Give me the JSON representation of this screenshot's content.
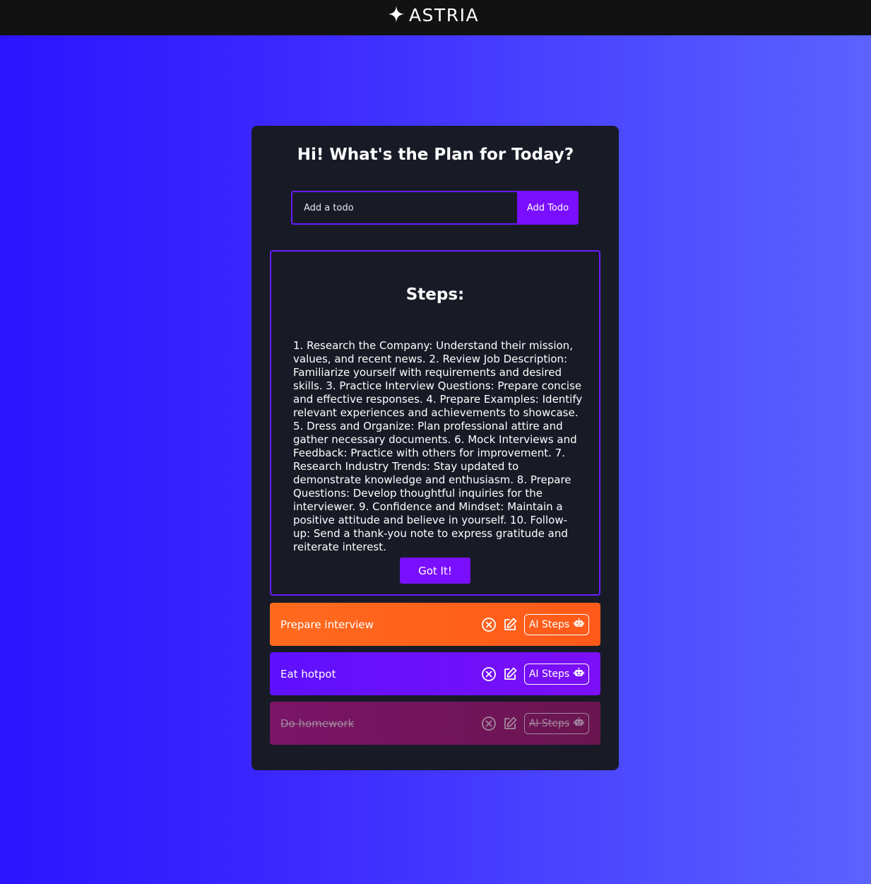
{
  "header": {
    "brand": "ASTRIA"
  },
  "main": {
    "title": "Hi! What's the Plan for Today?",
    "input_placeholder": "Add a todo",
    "add_button_label": "Add Todo"
  },
  "steps_panel": {
    "heading": "Steps:",
    "text": "1. Research the Company: Understand their mission, values, and recent news. 2. Review Job Description: Familiarize yourself with requirements and desired skills. 3. Practice Interview Questions: Prepare concise and effective responses. 4. Prepare Examples: Identify relevant experiences and achievements to showcase. 5. Dress and Organize: Plan professional attire and gather necessary documents. 6. Mock Interviews and Feedback: Practice with others for improvement. 7. Research Industry Trends: Stay updated to demonstrate knowledge and enthusiasm. 8. Prepare Questions: Develop thoughtful inquiries for the interviewer. 9. Confidence and Mindset: Maintain a positive attitude and believe in yourself. 10. Follow-up: Send a thank-you note to express gratitude and reiterate interest.",
    "button_label": "Got It!"
  },
  "todos": [
    {
      "label": "Prepare interview",
      "ai_label": "AI Steps",
      "completed": false,
      "color": "#ff6a1e"
    },
    {
      "label": "Eat hotpot",
      "ai_label": "AI Steps",
      "completed": false,
      "color": "#6a10ff"
    },
    {
      "label": "Do homework",
      "ai_label": "AI Steps",
      "completed": true,
      "color": "#731560"
    }
  ],
  "icons": {
    "logo": "sparkle-icon",
    "delete": "circle-x-icon",
    "edit": "edit-icon",
    "ai": "robot-icon"
  },
  "colors": {
    "accent": "#7a0fff",
    "card_bg": "#181b26",
    "topbar_bg": "#121212"
  }
}
